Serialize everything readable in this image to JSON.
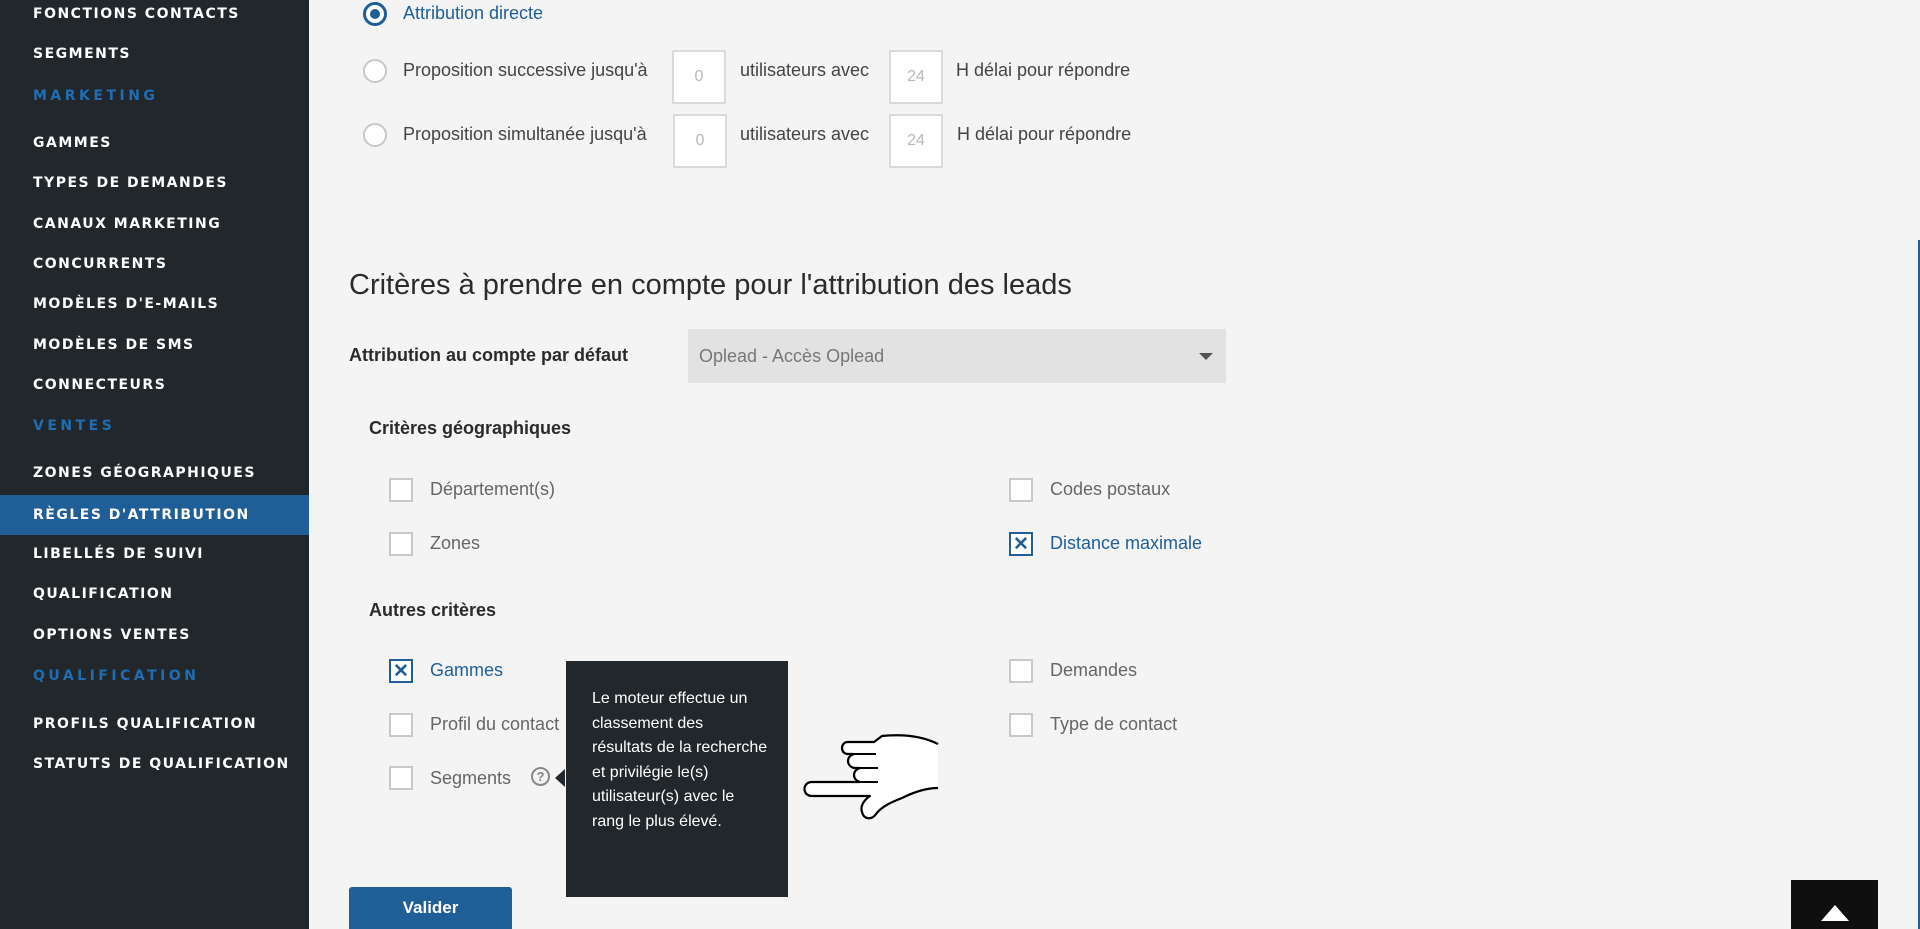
{
  "sidebar": {
    "items": [
      {
        "label": "FONCTIONS CONTACTS"
      },
      {
        "label": "SEGMENTS"
      },
      {
        "label": "GAMMES"
      },
      {
        "label": "TYPES DE DEMANDES"
      },
      {
        "label": "CANAUX MARKETING"
      },
      {
        "label": "CONCURRENTS"
      },
      {
        "label": "MODÈLES D'E-MAILS"
      },
      {
        "label": "MODÈLES DE SMS"
      },
      {
        "label": "CONNECTEURS"
      },
      {
        "label": "ZONES GÉOGRAPHIQUES"
      },
      {
        "label": "RÈGLES D'ATTRIBUTION"
      },
      {
        "label": "LIBELLÉS DE SUIVI"
      },
      {
        "label": "QUALIFICATION"
      },
      {
        "label": "OPTIONS VENTES"
      },
      {
        "label": "PROFILS QUALIFICATION"
      },
      {
        "label": "STATUTS DE QUALIFICATION"
      }
    ],
    "sections": {
      "marketing": "MARKETING",
      "ventes": "VENTES",
      "qualification": "QUALIFICATION"
    },
    "active_item": "RÈGLES D'ATTRIBUTION"
  },
  "attribution_mode": {
    "direct_label": "Attribution directe",
    "successive": {
      "label": "Proposition successive jusqu'à",
      "users_value": "0",
      "mid_label": "utilisateurs avec",
      "delay_value": "24",
      "end_label": "H délai pour répondre"
    },
    "simultaneous": {
      "label": "Proposition simultanée jusqu'à",
      "users_value": "0",
      "mid_label": "utilisateurs avec",
      "delay_value": "24",
      "end_label": "H délai pour répondre"
    },
    "selected": "Attribution directe"
  },
  "criteria": {
    "title": "Critères à prendre en compte pour l'attribution des leads",
    "default_account_label": "Attribution au compte par défaut",
    "default_account_value": "Oplead - Accès Oplead",
    "geo": {
      "title": "Critères géographiques",
      "departements": {
        "label": "Département(s)",
        "checked": false
      },
      "codes_postaux": {
        "label": "Codes postaux",
        "checked": false
      },
      "zones": {
        "label": "Zones",
        "checked": false
      },
      "distance": {
        "label": "Distance maximale",
        "checked": true
      }
    },
    "other": {
      "title": "Autres critères",
      "gammes": {
        "label": "Gammes",
        "checked": true
      },
      "demandes": {
        "label": "Demandes",
        "checked": false
      },
      "profil": {
        "label": "Profil du contact",
        "checked": false
      },
      "type_contact": {
        "label": "Type de contact",
        "checked": false
      },
      "segments": {
        "label": "Segments",
        "checked": false
      }
    }
  },
  "help_icon_glyph": "?",
  "tooltip_text": "Le moteur effectue un classement des résultats de la recherche et privilégie le(s) utilisateur(s) avec le rang le plus élevé.",
  "submit_label": "Valider",
  "check_glyph": "✕",
  "colors": {
    "sidebar_bg": "#22272b",
    "accent": "#1f5e97",
    "section_label": "#1f6eb5",
    "page_bg": "#f4f4f4"
  },
  "icons": [
    "radio-selected",
    "radio-empty",
    "checkbox-checked",
    "checkbox-empty",
    "dropdown-caret-icon",
    "help-icon",
    "pointing-hand-cursor",
    "scroll-to-top-icon"
  ]
}
